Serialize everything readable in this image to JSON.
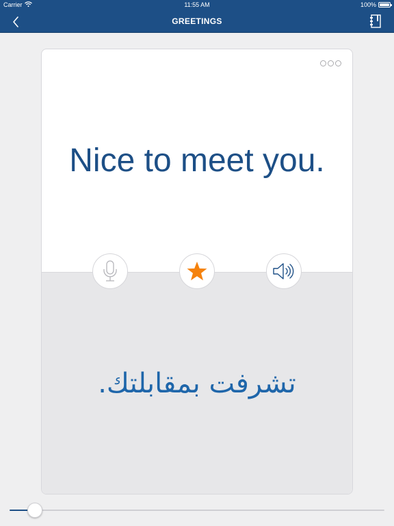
{
  "status_bar": {
    "carrier": "Carrier",
    "time": "11:55 AM",
    "battery_text": "100%",
    "battery_level": 1.0
  },
  "nav": {
    "title": "GREETINGS",
    "back_icon": "chevron-left-icon",
    "notebook_icon": "notebook-icon"
  },
  "card": {
    "phrase": "Nice to meet you.",
    "translation": "تشرفت بمقابلتك.",
    "more_icon": "more-dots-icon",
    "buttons": {
      "mic_icon": "microphone-icon",
      "star_icon": "star-icon",
      "speaker_icon": "speaker-icon"
    }
  },
  "progress": {
    "value": 0.05
  },
  "colors": {
    "nav_background": "#1d4f86",
    "phrase_text": "#1d4f86",
    "translation_text": "#1f66aa",
    "star": "#f5820d",
    "page_background": "#efeff0"
  }
}
